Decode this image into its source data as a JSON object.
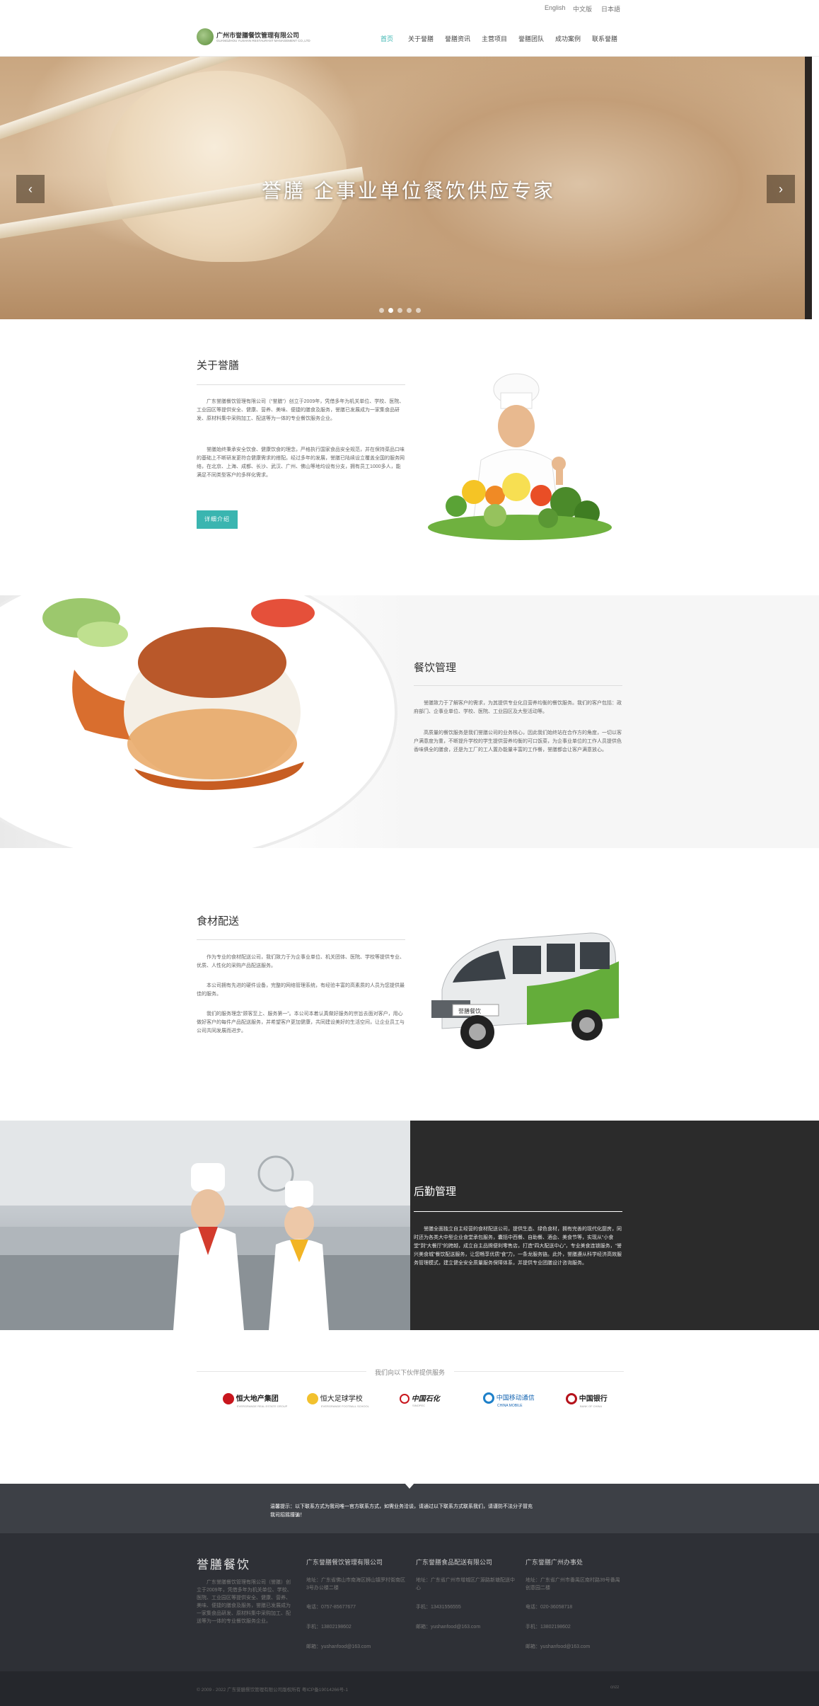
{
  "lang_bar": {
    "english": "English",
    "chinese": "中文版",
    "japanese": "日本語"
  },
  "logo": {
    "cn": "广州市誉膳餐饮管理有限公司",
    "en": "GUANGZHOU YUSHAN RESTAURANT MANAGEMENT CO.,LTD"
  },
  "nav": [
    "首页",
    "关于誉膳",
    "誉膳资讯",
    "主营项目",
    "誉膳团队",
    "成功案例",
    "联系誉膳"
  ],
  "hero": {
    "title": "誉膳 企事业单位餐饮供应专家",
    "prev": "‹",
    "next": "›",
    "slides": 5
  },
  "about": {
    "title": "关于誉膳",
    "p1": "广东誉膳餐饮管理有限公司（“誉膳”）创立于2009年，凭借多年为机关单位、学校、医院、工业园区等提供安全、健康、营养、美味、便捷的膳食及服务，誉膳已发展成为一家集食品研发、原材料集中采购加工、配送等为一体的专业餐饮服务企业。",
    "p2": "誉膳始终秉承安全饮食、健康饮食的理念，严格执行国家食品安全规范，并在保持菜品口味的基础上不断研发更符合健康需求的搭配。经过多年的发展，誉膳已陆续设立覆盖全国的服务网络，在北京、上海、成都、长沙、武汉、广州、佛山等地均设有分支，拥有员工1000多人，能满足不同类型客户的多样化需求。",
    "button": "详细介绍"
  },
  "catering": {
    "title": "餐饮管理",
    "p1": "誉膳致力于了解客户的需求，为其提供专业化且营养均衡的餐饮服务。我们的客户包括：政府部门、企事业单位、学校、医院、工业园区及大型活动等。",
    "p2": "高质量的餐饮服务是我们誉膳公司的业务核心，因此我们始终站在合作方的角度，一切以客户满意度为重，不断提升学校的学生提供营养均衡的可口饭菜，为企事业单位的工作人员提供色香味俱全的膳食，还是为工厂的工人置办能量丰富的工作餐，誉膳都会让客户满意放心。"
  },
  "delivery": {
    "title": "食材配送",
    "p1": "作为专业的食材配送公司，我们致力于为企事业单位、机关团体、医院、学校等提供专业、优质、人性化的采购产品配送服务。",
    "p2": "本公司拥有先进的硬件设备，完整的网络管理系统，有经验丰富的高素质的人员为您提供最佳的服务。",
    "p3": "我们的服务理念“顾客至上、服务第一”。本公司本着认真做好服务的宗旨去面对客户，用心做好客户的每件产品配送服务，并希望客户更加健康，共同建设美好的生活空间，让企业员工与公司共同发展而进步。",
    "van_label": "誉膳餐饮"
  },
  "logistics": {
    "title": "后勤管理",
    "p1": "誉膳全面独立自主经营的食材配送公司，提供生态、绿色食材，拥有完善的现代化厨房，同时还为各类大中型企业食堂承包服务，囊括中西餐、自助餐、酒会、美食节等，实现从“小食堂”到“大餐厅”的跨越，成立自主品牌便利零售店，打造“四大配送中心”，专业美食连锁服务，“誉兴美食城”餐饮配送服务，让您畅享优质“食”力，一条龙服务链。此外，誉膳遵从科学经济高效服务管理模式，建立健全安全质量服务保障体系，并提供专业团膳设计咨询服务。"
  },
  "partners": {
    "heading": "我们向以下伙伴提供服务",
    "items": [
      "恒大地产集团",
      "恒大足球学校",
      "中国石化",
      "中国移动通信",
      "中国银行"
    ],
    "sub": [
      "EVERGRANDE REAL ESTATE GROUP",
      "EVERGRANDE FOOTBALL SCHOOL",
      "SINOPEC",
      "CHINA MOBILE",
      "BANK OF CHINA"
    ]
  },
  "notice": {
    "text1": "温馨提示：以下联系方式为我司唯一官方联系方式，如需业务洽谈，请通过以下联系方式联系我们，请谨防不法分子冒充",
    "text2": "我司招摇撞骗！"
  },
  "footer": {
    "brand": "誉膳餐饮",
    "brand_text": "广东誉膳餐饮管理有限公司（誉膳）创立于2009年，凭借多年为机关单位、学校、医院、工业园区等提供安全、健康、营养、美味、便捷的膳食及服务，誉膳已发展成为一家集食品研发、原材料集中采购加工、配送等为一体的专业餐饮服务企业。",
    "cols": [
      {
        "title": "广东誉膳餐饮管理有限公司",
        "address": "地址：广东省佛山市南海区狮山镇罗村街南区3号办公楼二楼",
        "phone": "电话：0757-85677677",
        "mobile": "手机：13802198602",
        "email": "邮箱：yushanfood@163.com"
      },
      {
        "title": "广东誉膳食品配送有限公司",
        "address": "地址：广东省广州市增城区广源路新塘配送中心",
        "phone": "手机：13431556555",
        "mobile": "",
        "email": "邮箱：yushanfood@163.com"
      },
      {
        "title": "广东誉膳广州办事处",
        "address": "地址：广东省广州市番禺区南村路39号番禺创意园二楼",
        "phone": "电话：020-36058718",
        "mobile": "手机：13802198602",
        "email": "邮箱：yushanfood@163.com"
      }
    ]
  },
  "copyright": {
    "text": "© 2009 - 2022 广东誉膳餐饮管理有限公司版权所有 粤ICP备19014266号-1",
    "icon": "cnzz"
  }
}
